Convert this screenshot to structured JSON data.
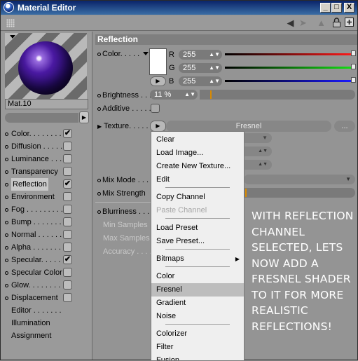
{
  "window": {
    "title": "Material Editor",
    "buttons": {
      "minimize": "_",
      "maximize": "□",
      "close": "X"
    }
  },
  "toolbar": {
    "icons": [
      "back-arrow-icon",
      "forward-arrow-icon",
      "up-arrow-icon",
      "lock-icon",
      "new-window-icon"
    ]
  },
  "left": {
    "material_name": "Mat.10",
    "channels": [
      {
        "label": "Color. . . . . . . .",
        "checked": true,
        "dot": true
      },
      {
        "label": "Diffusion . . . . . .",
        "checked": false,
        "dot": true
      },
      {
        "label": "Luminance . . . . .",
        "checked": false,
        "dot": true
      },
      {
        "label": "Transparency",
        "checked": false,
        "dot": true
      },
      {
        "label": "Reflection",
        "checked": true,
        "dot": true,
        "selected": true
      },
      {
        "label": "Environment",
        "checked": false,
        "dot": true
      },
      {
        "label": "Fog . . . . . . . . .",
        "checked": false,
        "dot": true
      },
      {
        "label": "Bump . . . . . . . .",
        "checked": false,
        "dot": true
      },
      {
        "label": "Normal . . . . . . .",
        "checked": false,
        "dot": true
      },
      {
        "label": "Alpha . . . . . . . .",
        "checked": false,
        "dot": true
      },
      {
        "label": "Specular. . . . . .",
        "checked": true,
        "dot": true
      },
      {
        "label": "Specular Color",
        "checked": false,
        "dot": true
      },
      {
        "label": "Glow. . . . . . . . .",
        "checked": false,
        "dot": true
      },
      {
        "label": "Displacement",
        "checked": false,
        "dot": true
      },
      {
        "label": "Editor . . . . . . .",
        "dot": false
      },
      {
        "label": "Illumination",
        "dot": false
      },
      {
        "label": "Assignment",
        "dot": false
      }
    ]
  },
  "right": {
    "section_title": "Reflection",
    "color_label": "Color. . . . .",
    "r": {
      "label": "R",
      "value": "255"
    },
    "g": {
      "label": "G",
      "value": "255"
    },
    "b": {
      "label": "B",
      "value": "255"
    },
    "brightness": {
      "label": "Brightness . . . .",
      "value": "11 %",
      "fraction": 0.11
    },
    "additive_label": "Additive . . . . .",
    "texture": {
      "label": "Texture. . . . . .",
      "shader": "Fresnel",
      "more_button": "..."
    },
    "mix_mode_label": "Mix Mode . . . .",
    "mix_strength_label": "Mix Strength",
    "blurriness_label": "Blurriness . . . .",
    "min_samples_label": "Min Samples",
    "max_samples_label": "Max Samples",
    "accuracy_label": "Accuracy . . . . .",
    "ghost_texture_mode": "e",
    "ghost_mix_mode": ""
  },
  "context_menu": {
    "items": [
      {
        "label": "Clear"
      },
      {
        "label": "Load Image..."
      },
      {
        "label": "Create New Texture..."
      },
      {
        "label": "Edit"
      },
      {
        "label": "Copy Channel"
      },
      {
        "label": "Paste Channel",
        "disabled": true
      },
      {
        "label": "Load Preset"
      },
      {
        "label": "Save Preset..."
      },
      {
        "label": "Bitmaps",
        "submenu": true
      },
      {
        "label": "Color"
      },
      {
        "label": "Fresnel",
        "highlighted": true
      },
      {
        "label": "Gradient"
      },
      {
        "label": "Noise"
      },
      {
        "label": "Colorizer"
      },
      {
        "label": "Filter"
      },
      {
        "label": "Fusion"
      }
    ]
  },
  "annotation": "WITH REFLECTION CHANNEL SELECTED, LETS NOW ADD A FRESNEL SHADER TO IT FOR MORE REALISTIC REFLECTIONS!"
}
